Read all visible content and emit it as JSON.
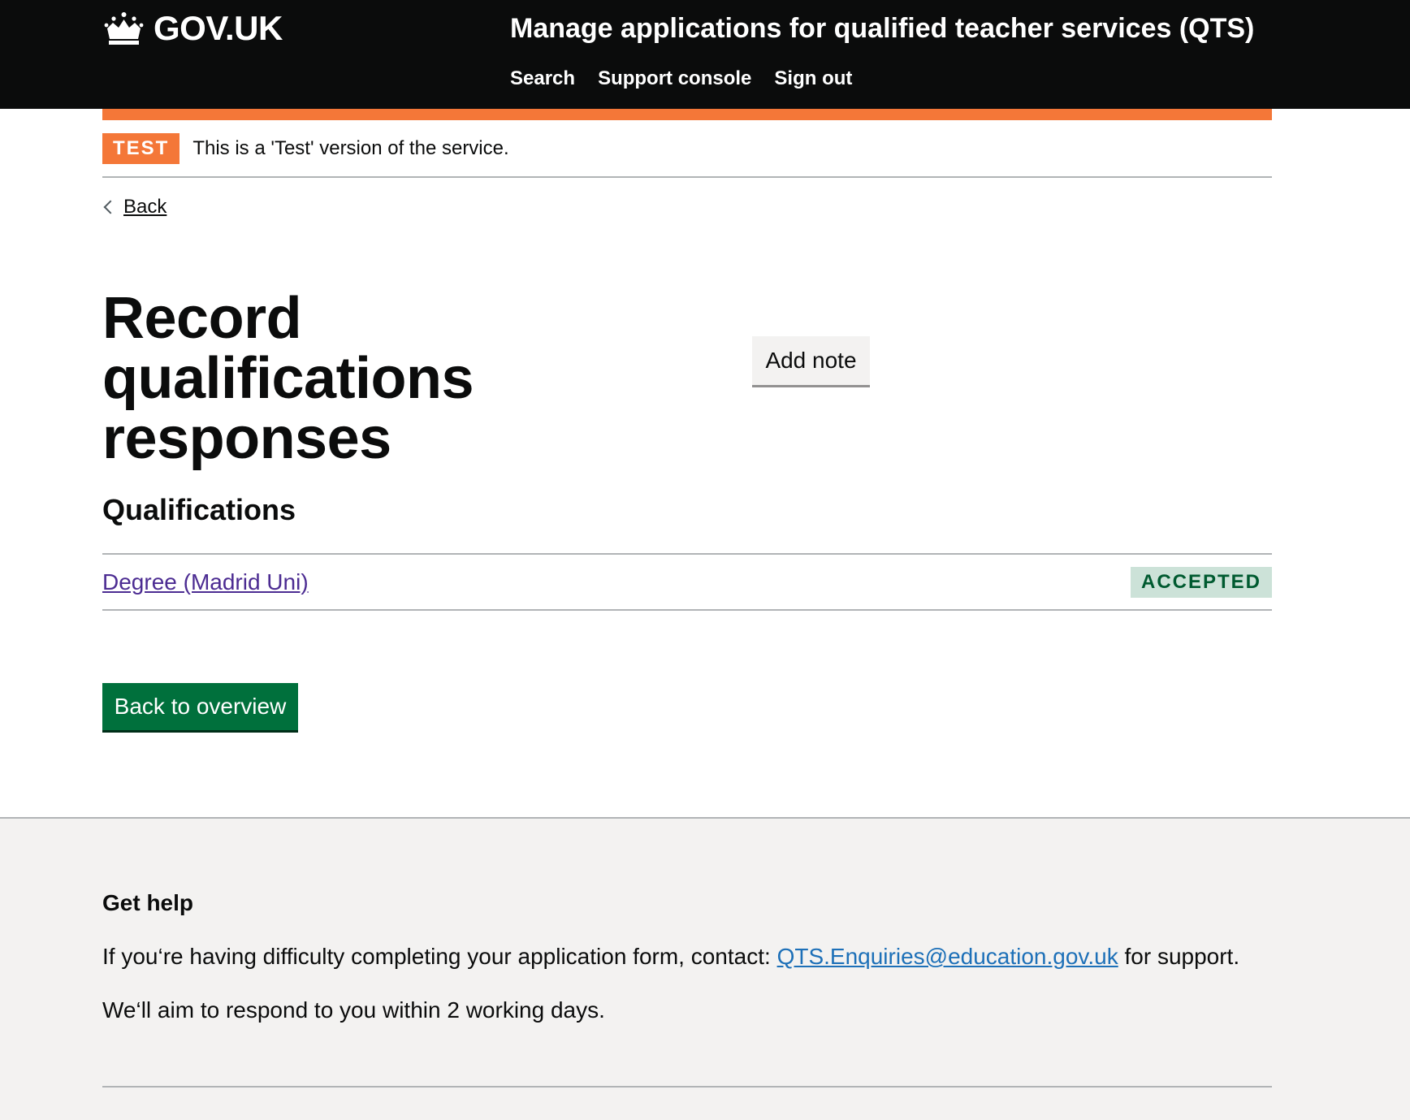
{
  "header": {
    "logo_text": "GOV.UK",
    "service_name": "Manage applications for qualified teacher services (QTS)",
    "nav": [
      {
        "label": "Search"
      },
      {
        "label": "Support console"
      },
      {
        "label": "Sign out"
      }
    ]
  },
  "phase_banner": {
    "tag": "TEST",
    "text": "This is a 'Test' version of the service."
  },
  "back_link": "Back",
  "page": {
    "title": "Record qualifications responses",
    "add_note_label": "Add note",
    "section_heading": "Qualifications",
    "qualifications": [
      {
        "name": "Degree (Madrid Uni)",
        "status": "ACCEPTED"
      }
    ],
    "back_to_overview_label": "Back to overview"
  },
  "footer": {
    "heading": "Get help",
    "help_text_before": "If you‘re having difficulty completing your application form, contact: ",
    "help_email": "QTS.Enquiries@education.gov.uk",
    "help_text_after": " for support.",
    "respond_text": "We‘ll aim to respond to you within 2 working days."
  },
  "colors": {
    "header_bg": "#0b0c0c",
    "phase_orange": "#f47738",
    "link_visited": "#4c2c92",
    "link": "#1d70b8",
    "primary_green": "#00703c",
    "status_green_bg": "#cce2d8",
    "status_green_text": "#005a30"
  }
}
